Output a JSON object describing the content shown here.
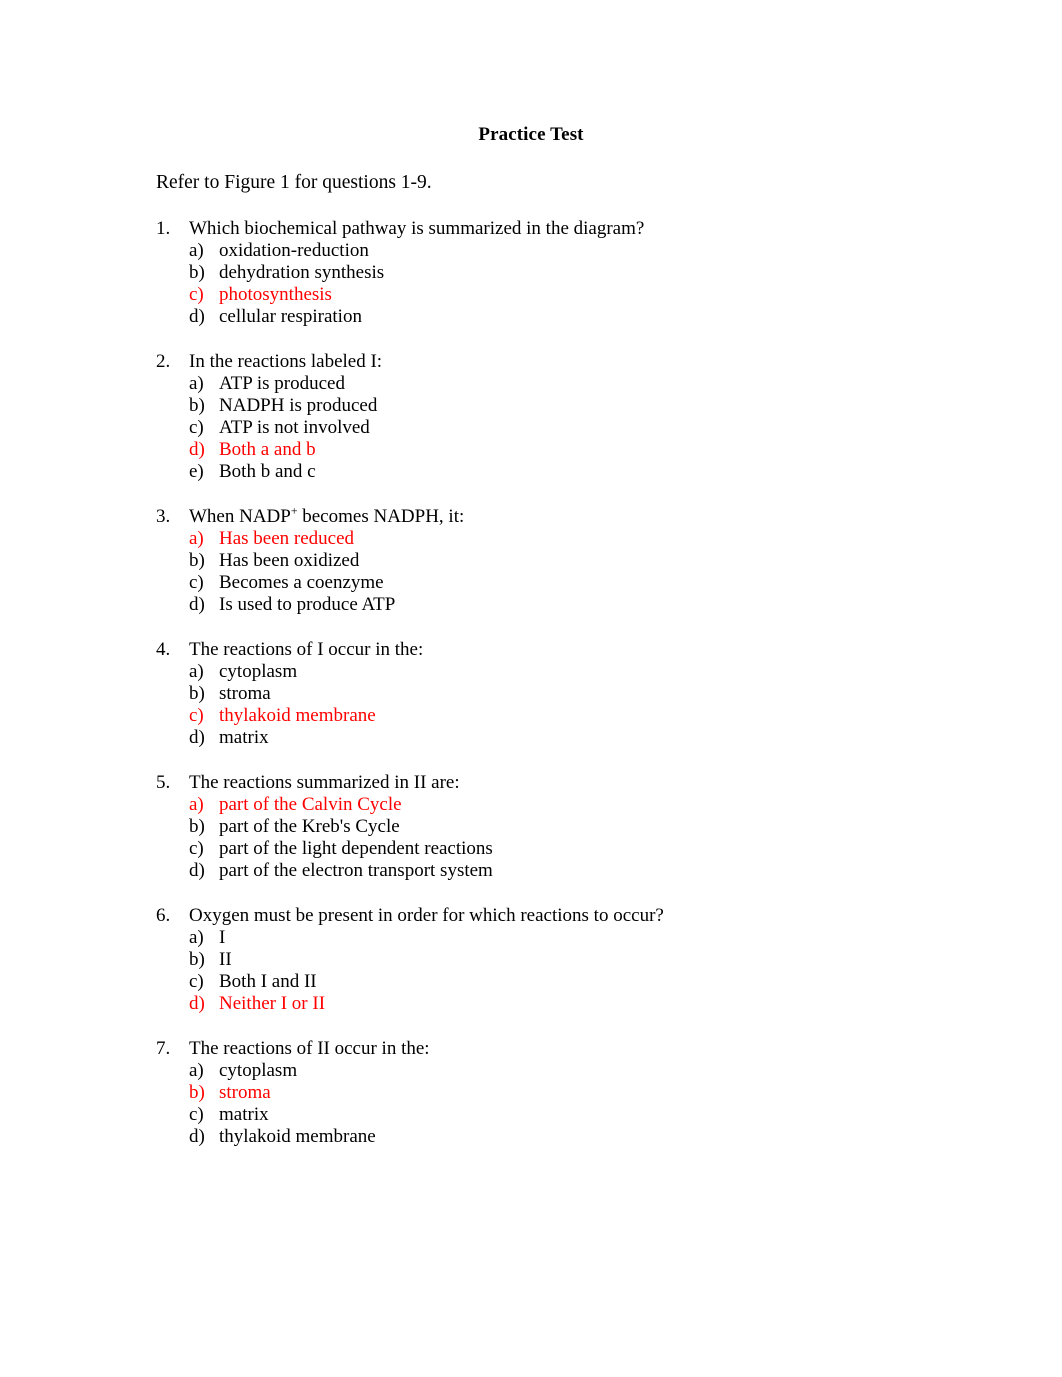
{
  "document": {
    "title": "Practice Test",
    "intro": "Refer to Figure 1 for questions 1-9.",
    "answer_color": "#ff0000",
    "text_color": "#000000",
    "background_color": "#ffffff"
  },
  "questions": [
    {
      "number": "1.",
      "text": "Which biochemical pathway is summarized in the diagram?",
      "options": [
        {
          "letter": "a)",
          "text": "oxidation-reduction",
          "is_answer": false
        },
        {
          "letter": "b)",
          "text": "dehydration synthesis",
          "is_answer": false
        },
        {
          "letter": "c)",
          "text": "photosynthesis",
          "is_answer": true
        },
        {
          "letter": "d)",
          "text": "cellular respiration",
          "is_answer": false
        }
      ]
    },
    {
      "number": "2.",
      "text": "In the reactions labeled I:",
      "options": [
        {
          "letter": "a)",
          "text": "ATP is produced",
          "is_answer": false
        },
        {
          "letter": "b)",
          "text": "NADPH is produced",
          "is_answer": false
        },
        {
          "letter": "c)",
          "text": "ATP is not involved",
          "is_answer": false
        },
        {
          "letter": "d)",
          "text": "Both a and b",
          "is_answer": true
        },
        {
          "letter": "e)",
          "text": "Both b and c",
          "is_answer": false
        }
      ]
    },
    {
      "number": "3.",
      "text": "When NADP+ becomes NADPH, it:",
      "text_html": "When NADP<sup>+</sup> becomes NADPH, it:",
      "options": [
        {
          "letter": "a)",
          "text": "Has been reduced",
          "is_answer": true
        },
        {
          "letter": "b)",
          "text": "Has been oxidized",
          "is_answer": false
        },
        {
          "letter": "c)",
          "text": "Becomes a coenzyme",
          "is_answer": false
        },
        {
          "letter": "d)",
          "text": "Is used to produce ATP",
          "is_answer": false
        }
      ]
    },
    {
      "number": "4.",
      "text": "The reactions of I occur in the:",
      "options": [
        {
          "letter": "a)",
          "text": "cytoplasm",
          "is_answer": false
        },
        {
          "letter": "b)",
          "text": "stroma",
          "is_answer": false
        },
        {
          "letter": "c)",
          "text": "thylakoid membrane",
          "is_answer": true
        },
        {
          "letter": "d)",
          "text": "matrix",
          "is_answer": false
        }
      ]
    },
    {
      "number": "5.",
      "text": "The reactions summarized in II are:",
      "options": [
        {
          "letter": "a)",
          "text": "part of the Calvin Cycle",
          "is_answer": true
        },
        {
          "letter": "b)",
          "text": "part of the Kreb's Cycle",
          "is_answer": false
        },
        {
          "letter": "c)",
          "text": "part of the light dependent reactions",
          "is_answer": false
        },
        {
          "letter": "d)",
          "text": "part of the electron transport system",
          "is_answer": false
        }
      ]
    },
    {
      "number": "6.",
      "text": "Oxygen must be present in order for which reactions to occur?",
      "options": [
        {
          "letter": "a)",
          "text": "I",
          "is_answer": false
        },
        {
          "letter": "b)",
          "text": "II",
          "is_answer": false
        },
        {
          "letter": "c)",
          "text": "Both I and II",
          "is_answer": false
        },
        {
          "letter": "d)",
          "text": "Neither I or II",
          "is_answer": true
        }
      ]
    },
    {
      "number": "7.",
      "text": "The reactions of II occur in the:",
      "options": [
        {
          "letter": "a)",
          "text": "cytoplasm",
          "is_answer": false
        },
        {
          "letter": "b)",
          "text": "stroma",
          "is_answer": true
        },
        {
          "letter": "c)",
          "text": "matrix",
          "is_answer": false
        },
        {
          "letter": "d)",
          "text": "thylakoid membrane",
          "is_answer": false
        }
      ]
    }
  ]
}
